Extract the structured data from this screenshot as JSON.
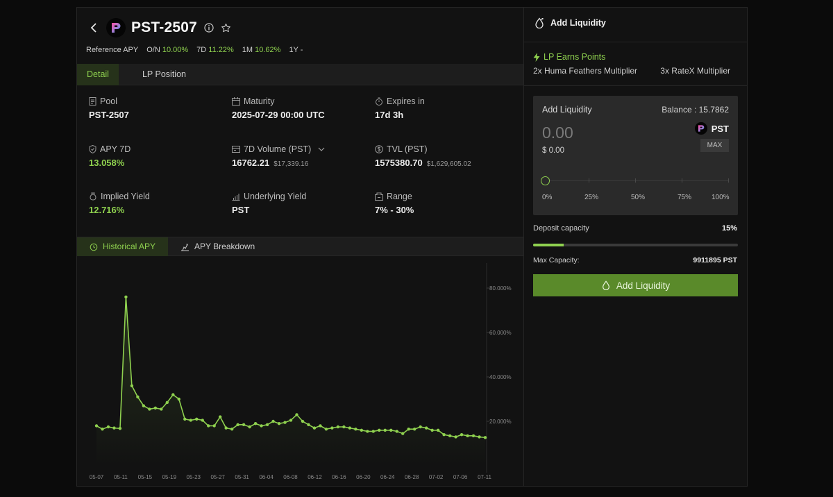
{
  "header": {
    "title": "PST-2507",
    "reference_apy_label": "Reference APY",
    "on_label": "O/N",
    "on_value": "10.00%",
    "d7_label": "7D",
    "d7_value": "11.22%",
    "m1_label": "1M",
    "m1_value": "10.62%",
    "y1_label": "1Y",
    "y1_value": "-"
  },
  "tabs": [
    {
      "label": "Detail",
      "active": true
    },
    {
      "label": "LP Position",
      "active": false
    }
  ],
  "stats": {
    "pool": {
      "label": "Pool",
      "value": "PST-2507"
    },
    "maturity": {
      "label": "Maturity",
      "value": "2025-07-29 00:00 UTC"
    },
    "expires": {
      "label": "Expires in",
      "value": "17d 3h"
    },
    "apy7d": {
      "label": "APY 7D",
      "value": "13.058%"
    },
    "volume": {
      "label": "7D Volume  (PST)",
      "value": "16762.21",
      "sub": "$17,339.16"
    },
    "tvl": {
      "label": "TVL (PST)",
      "value": "1575380.70",
      "sub": "$1,629,605.02"
    },
    "implied": {
      "label": "Implied Yield",
      "value": "12.716%"
    },
    "underlying": {
      "label": "Underlying Yield",
      "value": "PST"
    },
    "range": {
      "label": "Range",
      "value": "7% - 30%"
    }
  },
  "chart_tabs": [
    {
      "label": "Historical APY",
      "active": true
    },
    {
      "label": "APY Breakdown",
      "active": false
    }
  ],
  "chart_data": {
    "type": "line",
    "ylim": [
      0,
      90
    ],
    "yticks": [
      20,
      40,
      60,
      80
    ],
    "ytick_labels": [
      "20.000%",
      "40.000%",
      "60.000%",
      "80.000%"
    ],
    "xtick_labels": [
      "05-07",
      "05-11",
      "05-15",
      "05-19",
      "05-23",
      "05-27",
      "05-31",
      "06-04",
      "06-08",
      "06-12",
      "06-16",
      "06-20",
      "06-24",
      "06-28",
      "07-02",
      "07-06",
      "07-11"
    ],
    "series": [
      {
        "values": [
          18,
          16.5,
          17.5,
          17,
          16.8,
          76,
          36,
          31,
          27,
          25.5,
          26,
          25.5,
          28.5,
          32,
          30,
          21,
          20.5,
          21,
          20.5,
          18,
          18,
          22,
          17,
          16.5,
          18.5,
          18.5,
          17.5,
          19,
          18,
          18.5,
          20,
          19,
          19.5,
          20.5,
          23,
          20,
          18.5,
          17,
          18,
          16.5,
          17,
          17.5,
          17.5,
          17,
          16.5,
          16,
          15.5,
          15.5,
          16,
          16,
          16,
          15.5,
          14.5,
          16.5,
          16.5,
          17.5,
          17,
          16,
          16,
          14,
          13.5,
          13,
          14,
          13.5,
          13.5,
          13,
          12.7
        ]
      }
    ]
  },
  "panel": {
    "title": "Add Liquidity",
    "earn_label": "LP Earns Points",
    "mult1": "2x Huma Feathers Multiplier",
    "mult2": "3x RateX Multiplier",
    "card_label": "Add Liquidity",
    "balance": "Balance : 15.7862",
    "amount": "0.00",
    "usd": "$ 0.00",
    "token": "PST",
    "max": "MAX",
    "pcts": [
      "0%",
      "25%",
      "50%",
      "75%",
      "100%"
    ],
    "deposit_label": "Deposit capacity",
    "deposit_pct": "15%",
    "deposit_fraction": 0.15,
    "max_cap_label": "Max Capacity:",
    "max_cap_value": "9911895 PST",
    "button": "Add Liquidity"
  },
  "colors": {
    "accent": "#8fd14f",
    "button": "#5a8a2a",
    "bg": "#121212"
  }
}
